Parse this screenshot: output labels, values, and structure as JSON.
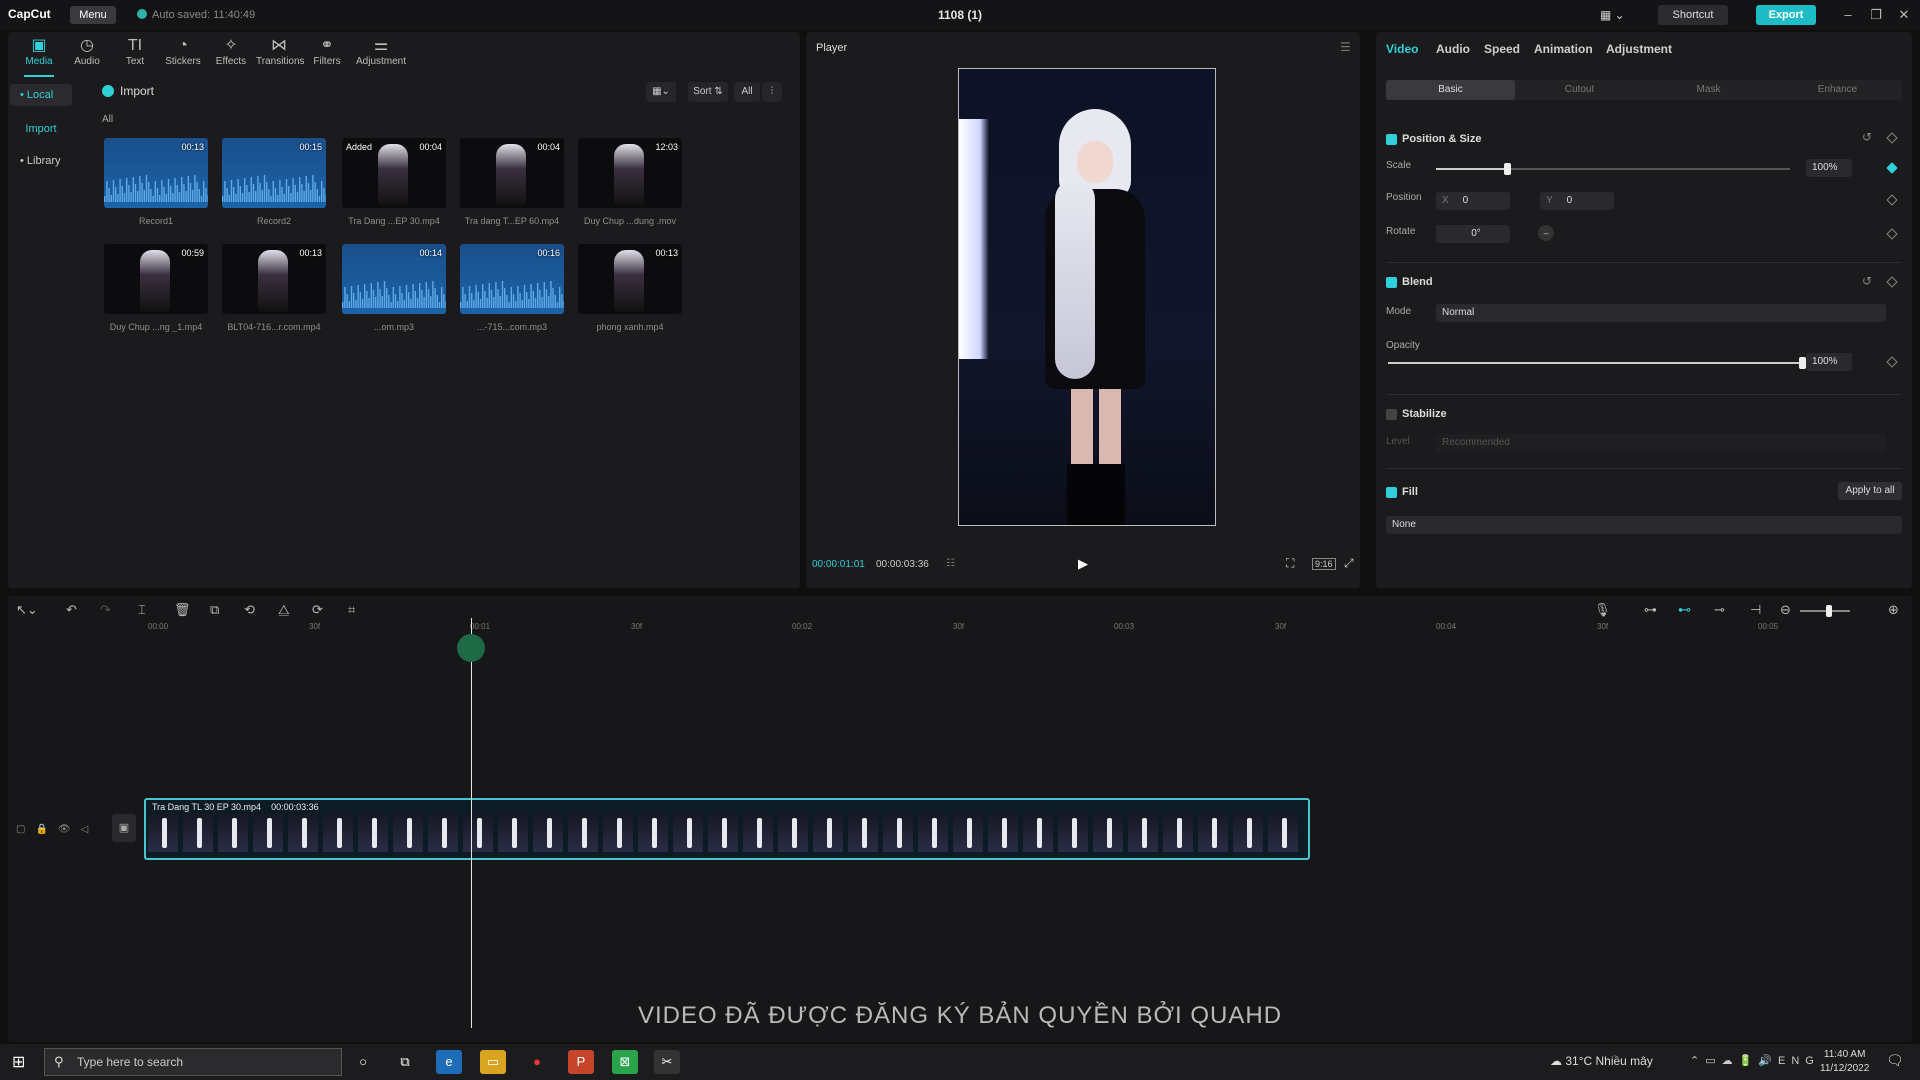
{
  "app": {
    "logo": "CapCut",
    "menu": "Menu",
    "autosave": "Auto saved: 11:40:49",
    "project_title": "1108 (1)",
    "shortcut": "Shortcut",
    "export": "Export"
  },
  "toolbar": {
    "items": [
      {
        "label": "Media",
        "icon": "media-icon"
      },
      {
        "label": "Audio",
        "icon": "audio-icon"
      },
      {
        "label": "Text",
        "icon": "text-icon"
      },
      {
        "label": "Stickers",
        "icon": "stickers-icon"
      },
      {
        "label": "Effects",
        "icon": "effects-icon"
      },
      {
        "label": "Transitions",
        "icon": "transitions-icon"
      },
      {
        "label": "Filters",
        "icon": "filters-icon"
      },
      {
        "label": "Adjustment",
        "icon": "adjustment-icon"
      }
    ]
  },
  "sidebar": {
    "local": "• Local",
    "import": "Import",
    "library": "• Library"
  },
  "media": {
    "import": "Import",
    "sort": "Sort",
    "all_filter": "All",
    "all_heading": "All",
    "items": [
      {
        "name": "Record1",
        "duration": "00:13",
        "kind": "audio"
      },
      {
        "name": "Record2",
        "duration": "00:15",
        "kind": "audio"
      },
      {
        "name": "Tra Dang ...EP 30.mp4",
        "duration": "00:04",
        "kind": "video",
        "badge": "Added"
      },
      {
        "name": "Tra dang T...EP 60.mp4",
        "duration": "00:04",
        "kind": "video"
      },
      {
        "name": "Duy Chup ...dung .mov",
        "duration": "12:03",
        "kind": "video"
      },
      {
        "name": "Duy Chup ...ng _1.mp4",
        "duration": "00:59",
        "kind": "video"
      },
      {
        "name": "BLT04-716...r.com.mp4",
        "duration": "00:13",
        "kind": "video"
      },
      {
        "name": "...om.mp3",
        "duration": "00:14",
        "kind": "audio"
      },
      {
        "name": "...-715...com.mp3",
        "duration": "00:16",
        "kind": "audio"
      },
      {
        "name": "phong xanh.mp4",
        "duration": "00:13",
        "kind": "video"
      }
    ]
  },
  "player": {
    "title": "Player",
    "current_time": "00:00:01:01",
    "total_time": "00:00:03:36",
    "ratio": "9:16"
  },
  "props": {
    "tabs": [
      "Video",
      "Audio",
      "Speed",
      "Animation",
      "Adjustment"
    ],
    "subtabs": [
      "Basic",
      "Cutout",
      "Mask",
      "Enhance"
    ],
    "position_size": "Position & Size",
    "scale_label": "Scale",
    "scale_value": "100%",
    "scale_fraction": 0.2,
    "position_label": "Position",
    "x_label": "X",
    "x_value": "0",
    "y_label": "Y",
    "y_value": "0",
    "rotate_label": "Rotate",
    "rotate_value": "0°",
    "blend": "Blend",
    "mode_label": "Mode",
    "mode_value": "Normal",
    "opacity_label": "Opacity",
    "opacity_value": "100%",
    "opacity_fraction": 1.0,
    "stabilize": "Stabilize",
    "level_label": "Level",
    "level_value": "Recommended",
    "fill": "Fill",
    "apply_all": "Apply to all",
    "fill_value": "None"
  },
  "timeline": {
    "ticks": [
      "00:00",
      "30f",
      "00:01",
      "30f",
      "00:02",
      "30f",
      "00:03",
      "30f",
      "00:04",
      "30f",
      "00:05"
    ],
    "clip_name": "Tra Dang TL 30 EP 30.mp4",
    "clip_duration": "00:00:03:36"
  },
  "watermark": "VIDEO ĐÃ ĐƯỢC ĐĂNG KÝ BẢN QUYỀN BỞI QUAHD",
  "taskbar": {
    "search_placeholder": "Type here to search",
    "weather": "31°C  Nhiều mây",
    "time": "11:40 AM",
    "date": "11/12/2022"
  }
}
